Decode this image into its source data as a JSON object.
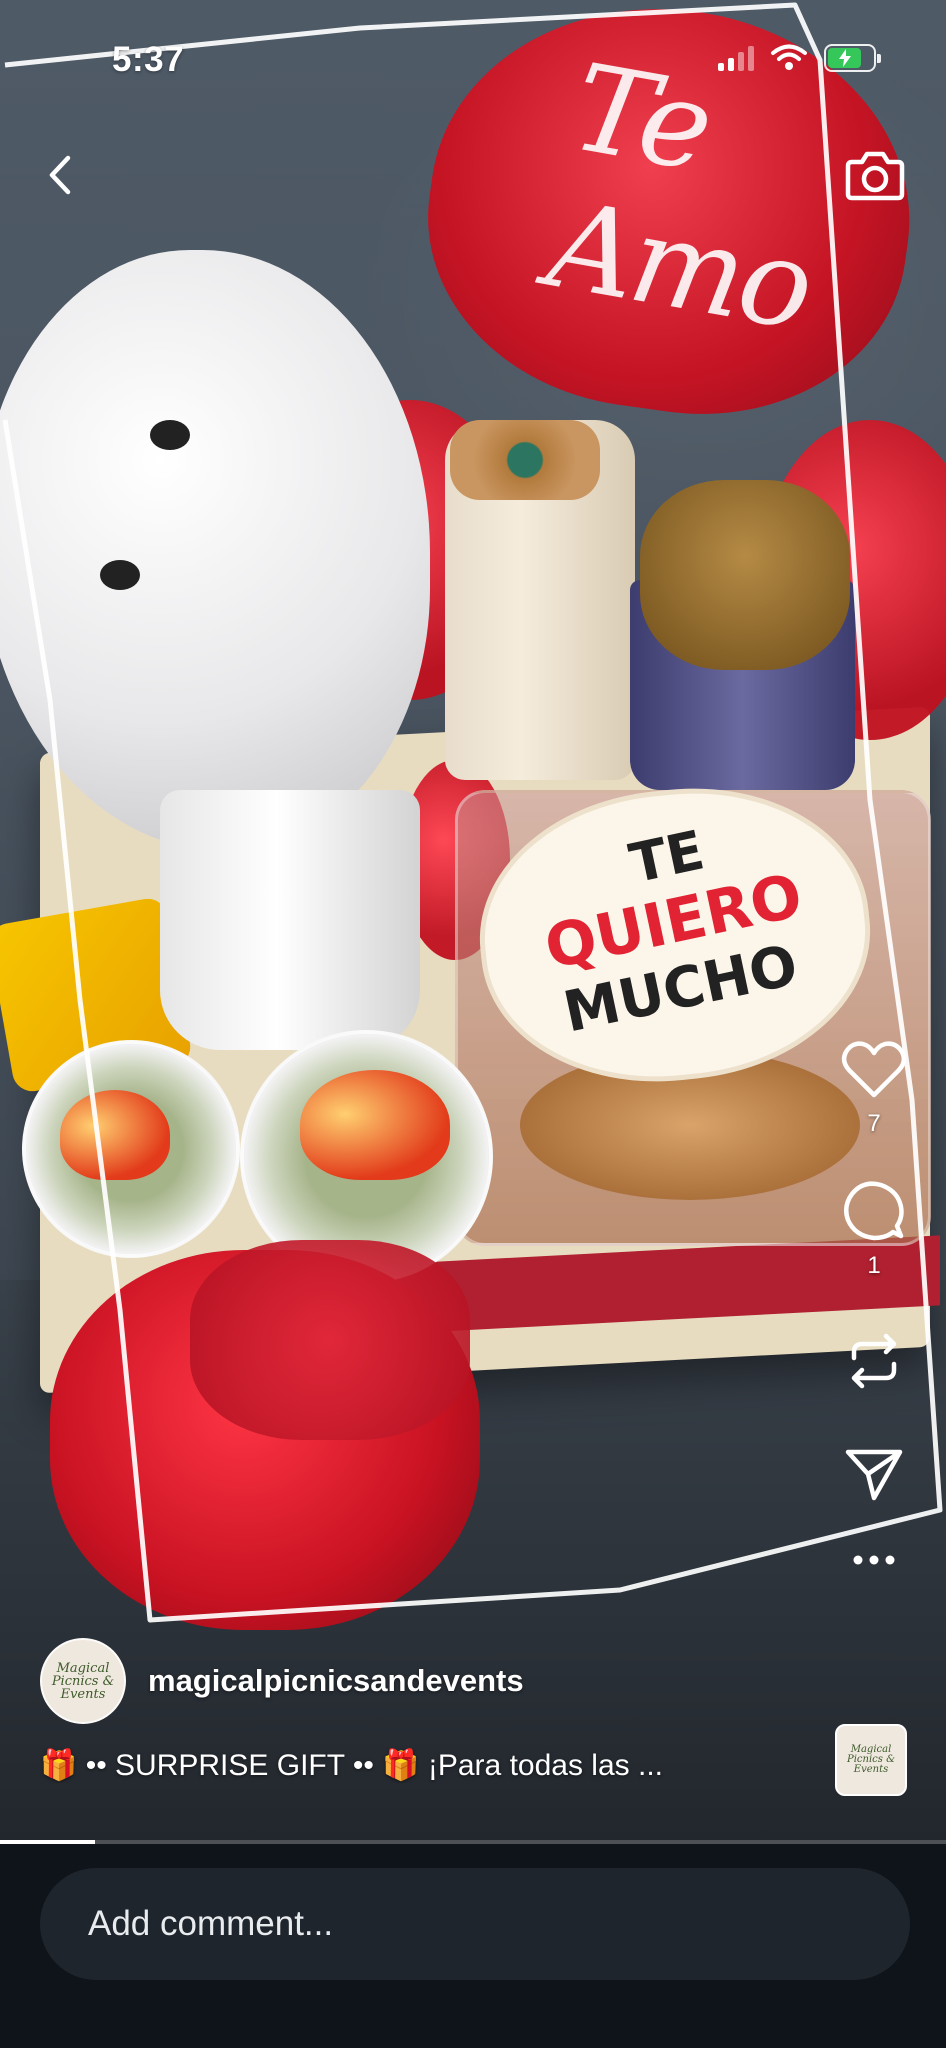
{
  "status_bar": {
    "time": "5:37",
    "battery_level": 0.75,
    "battery_color": "#35c759"
  },
  "post": {
    "username": "magicalpicnicsandevents",
    "avatar_text": "Magical Picnics & Events",
    "caption": "🎁 •• SURPRISE GIFT •• 🎁 ¡Para todas las ...",
    "audio_thumb_text": "Magical Picnics & Events"
  },
  "photo": {
    "balloon_text": "Te Amo",
    "sign_lines": [
      "TE",
      "QUIERO",
      "MUCHO"
    ],
    "accent_red": "#e22333"
  },
  "actions": {
    "like_count": "7",
    "comment_count": "1",
    "icons": [
      "heart-icon",
      "comment-icon",
      "repost-icon",
      "send-icon",
      "more-icon"
    ]
  },
  "progress": {
    "fraction": 0.1
  },
  "comment": {
    "placeholder": "Add comment..."
  }
}
